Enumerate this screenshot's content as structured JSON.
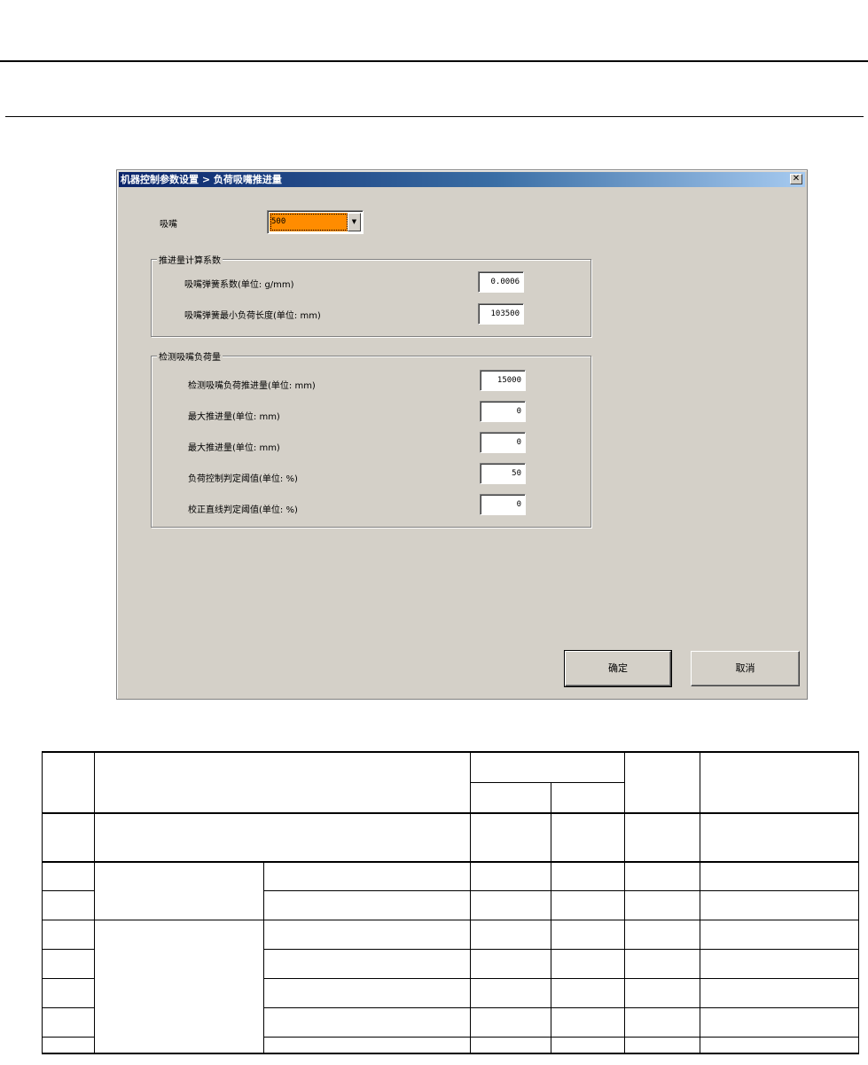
{
  "dialog": {
    "title": "机器控制参数设置 > 负荷吸嘴推进量",
    "close_glyph": "✕",
    "nozzle": {
      "label": "吸嘴",
      "value": "500"
    },
    "group_calc": {
      "title": "推进量计算系数",
      "rows": [
        {
          "label": "吸嘴弹簧系数(单位: g/mm)",
          "value": "0.0006"
        },
        {
          "label": "吸嘴弹簧最小负荷长度(单位: mm)",
          "value": "103500"
        }
      ]
    },
    "group_detect": {
      "title": "检测吸嘴负荷量",
      "rows": [
        {
          "label": "检测吸嘴负荷推进量(单位: mm)",
          "value": "15000"
        },
        {
          "label": "最大推进量(单位: mm)",
          "value": "0"
        },
        {
          "label": "最大推进量(单位: mm)",
          "value": "0"
        },
        {
          "label": "负荷控制判定阈值(单位: %)",
          "value": "50"
        },
        {
          "label": "校正直线判定阈值(单位: %)",
          "value": "0"
        }
      ]
    },
    "ok_label": "确定",
    "cancel_label": "取消"
  },
  "accent": {
    "selected_field": "#ff8c00",
    "titlebar_start": "#0a246a",
    "titlebar_end": "#a6caf0"
  }
}
